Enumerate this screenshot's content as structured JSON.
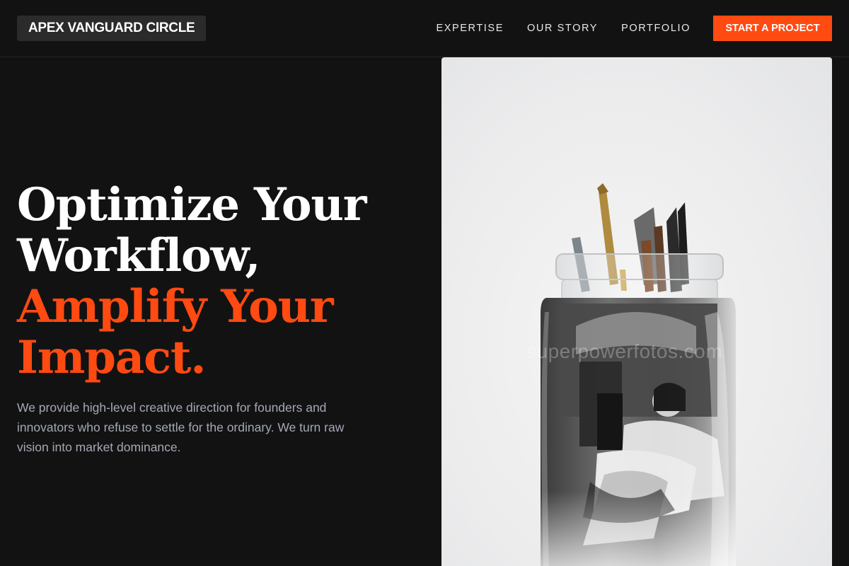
{
  "brand": {
    "name": "APEX VANGUARD CIRCLE"
  },
  "nav": {
    "links": [
      "EXPERTISE",
      "OUR STORY",
      "PORTFOLIO"
    ],
    "cta_label": "START A PROJECT"
  },
  "hero": {
    "headline_line1": "Optimize Your",
    "headline_line2": "Workflow,",
    "headline_line3": "Amplify Your",
    "headline_line4": "Impact.",
    "description": "We provide high-level creative direction for founders and innovators who refuse to settle for the ordinary. We turn raw vision into market dominance.",
    "image": {
      "subject": "glass jar holding paintbrushes with a black-and-white photo of a woman inside",
      "watermark": "superpowerfotos.com"
    }
  },
  "colors": {
    "background": "#121212",
    "accent": "#ff4a12",
    "text_primary": "#ffffff",
    "text_muted": "#a4a9b4",
    "logo_bg": "#2b2b2b"
  }
}
